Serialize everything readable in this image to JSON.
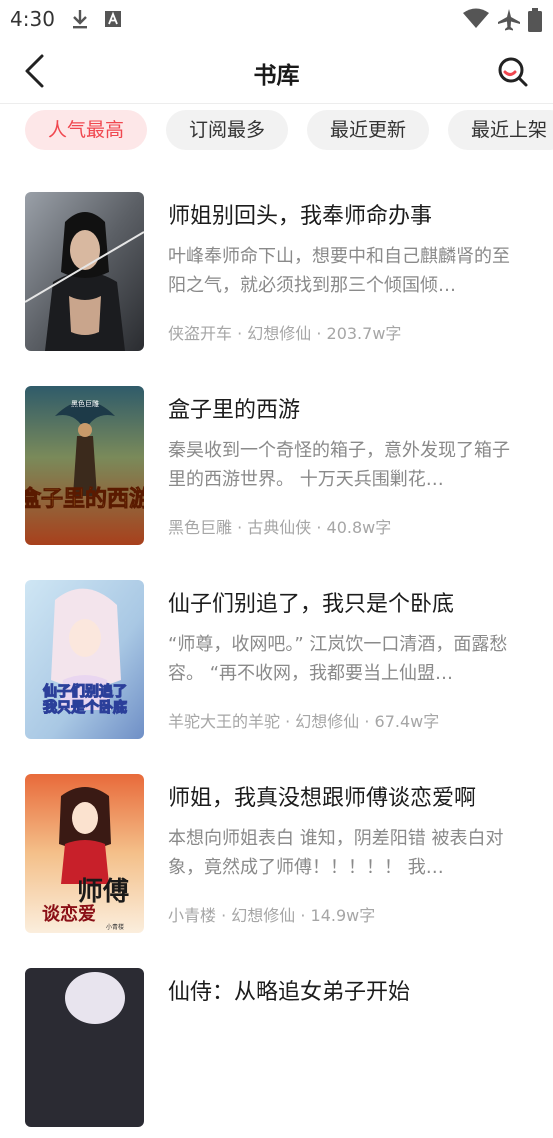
{
  "status_bar": {
    "time": "4:30",
    "icons": [
      "download-icon",
      "a-notification-icon",
      "wifi-icon",
      "airplane-icon",
      "battery-icon"
    ]
  },
  "header": {
    "title": "书库",
    "back_icon": "chevron-left-icon",
    "search_icon": "search-icon"
  },
  "tabs": [
    {
      "label": "人气最高",
      "active": true
    },
    {
      "label": "订阅最多",
      "active": false
    },
    {
      "label": "最近更新",
      "active": false
    },
    {
      "label": "最近上架",
      "active": false
    }
  ],
  "books": [
    {
      "title": "师姐别回头，我奉师命办事",
      "description": "叶峰奉师命下山，想要中和自己麒麟肾的至阳之气，就必须找到那三个倾国倾…",
      "meta": "侠盗开车 · 幻想修仙 · 203.7w字"
    },
    {
      "title": "盒子里的西游",
      "description": "秦昊收到一个奇怪的箱子，意外发现了箱子里的西游世界。 十万天兵围剿花…",
      "meta": "黑色巨雕 · 古典仙侠 · 40.8w字",
      "cover_text": "盒子里的西游",
      "cover_author": "黑色巨雕"
    },
    {
      "title": "仙子们别追了，我只是个卧底",
      "description": "“师尊，收网吧。” 江岚饮一口清酒，面露愁容。 “再不收网，我都要当上仙盟…",
      "meta": "羊驼大王的羊驼 · 幻想修仙 · 67.4w字",
      "cover_text_1": "仙子们别追了",
      "cover_text_2": "我只是个卧底"
    },
    {
      "title": "师姐，我真没想跟师傅谈恋爱啊",
      "description": "本想向师姐表白 谁知，阴差阳错 被表白对象，竟然成了师傅！！！！！ 我…",
      "meta": "小青楼 · 幻想修仙 · 14.9w字",
      "cover_text_1": "师傅",
      "cover_text_2": "谈恋爱",
      "cover_author": "小青楼"
    },
    {
      "title": "仙侍：从略追女弟子开始",
      "description": "",
      "meta": ""
    }
  ],
  "colors": {
    "accent": "#f0474f",
    "active_tab_bg": "#fde7e8",
    "tab_bg": "#f2f2f2"
  }
}
